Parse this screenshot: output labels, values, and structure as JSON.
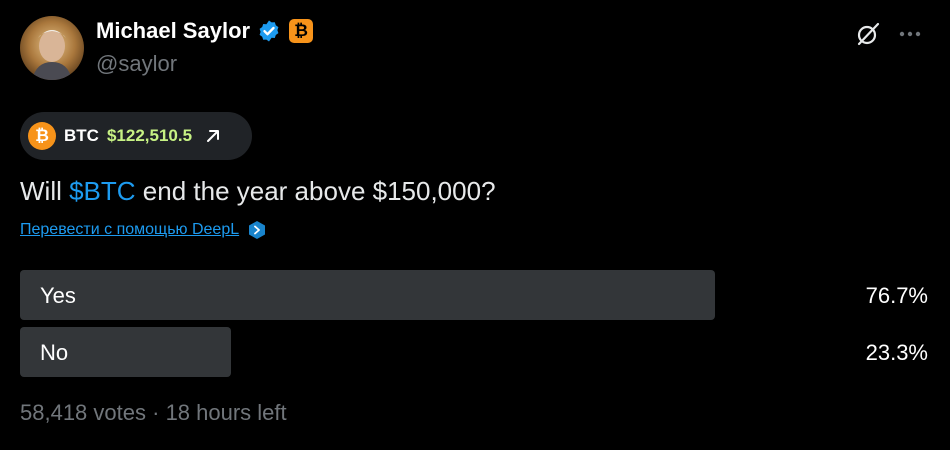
{
  "author": {
    "name": "Michael Saylor",
    "handle": "@saylor",
    "badge_glyph": "₿"
  },
  "ticker": {
    "coin_glyph": "₿",
    "symbol": "BTC",
    "price": "$122,510.5"
  },
  "post": {
    "question_prefix": "Will ",
    "cashtag": "$BTC",
    "question_suffix": " end the year above $150,000?",
    "translate_label": "Перевести с помощью DeepL"
  },
  "poll": {
    "options": [
      {
        "label": "Yes",
        "percent": "76.7%",
        "fill_fraction": 0.767
      },
      {
        "label": "No",
        "percent": "23.3%",
        "fill_fraction": 0.233
      }
    ],
    "votes": "58,418 votes",
    "time_left": "18 hours left",
    "separator": "·"
  },
  "colors": {
    "background": "#000000",
    "accent_link": "#1d9bf0",
    "price_green": "#c7f284",
    "bitcoin_orange": "#f7931a",
    "muted_text": "#71767b",
    "poll_bar": "#333639"
  },
  "icons": [
    "verified-badge-icon",
    "bitcoin-badge-icon",
    "grok-icon",
    "more-icon",
    "arrow-up-right-icon",
    "deepl-icon",
    "bitcoin-coin-icon"
  ]
}
